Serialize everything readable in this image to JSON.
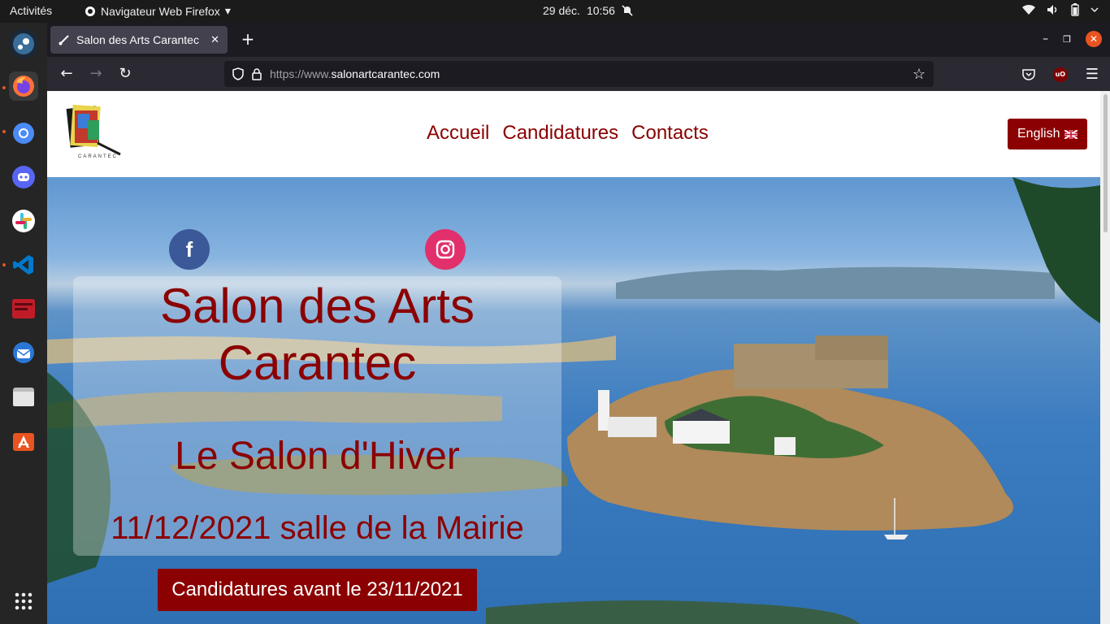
{
  "topbar": {
    "activities": "Activités",
    "app_name": "Navigateur Web Firefox",
    "date": "29 déc.",
    "time": "10:56"
  },
  "dock": {
    "items": [
      "steam-icon",
      "firefox-icon",
      "chromium-icon",
      "discord-icon",
      "slack-icon",
      "vscode-icon",
      "terminal-icon",
      "thunderbird-icon",
      "files-icon",
      "software-center-icon",
      "app-grid-icon"
    ]
  },
  "browser": {
    "tab_title": "Salon des Arts Carantec",
    "url_scheme": "https://www.",
    "url_host": "salonartcarantec.com"
  },
  "site": {
    "logo_text": "CARANTEC",
    "nav": {
      "home": "Accueil",
      "applications": "Candidatures",
      "contacts": "Contacts"
    },
    "lang_button": "English",
    "hero": {
      "title_line1": "Salon des Arts",
      "title_line2": "Carantec",
      "subtitle": "Le Salon d'Hiver",
      "date_place": "11/12/2021 salle de la Mairie",
      "cta": "Candidatures avant le 23/11/2021"
    }
  },
  "colors": {
    "brand": "#8b0000",
    "topbar": "#1b1b1b",
    "dock": "#252525",
    "firefox_tabbar": "#1c1b22",
    "firefox_navbar": "#2b2a33"
  }
}
